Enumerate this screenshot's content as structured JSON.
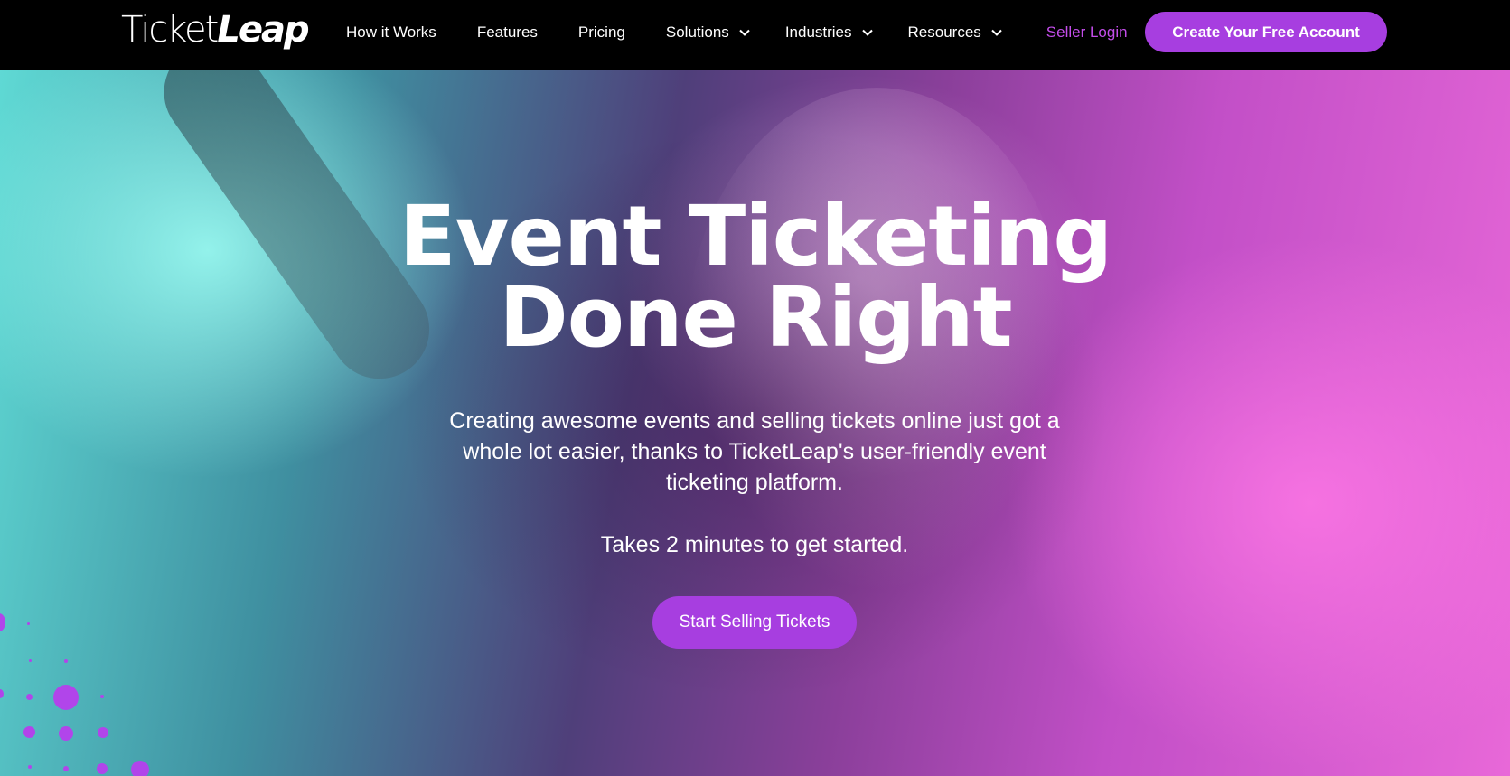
{
  "nav": {
    "logo_part1": "Ticket",
    "logo_part2": "Leap",
    "links": [
      {
        "label": "How it Works"
      },
      {
        "label": "Features"
      },
      {
        "label": "Pricing"
      },
      {
        "label": "Solutions",
        "dropdown": true
      },
      {
        "label": "Industries",
        "dropdown": true
      },
      {
        "label": "Resources",
        "dropdown": true
      }
    ],
    "seller_login": "Seller Login",
    "cta": "Create Your Free Account"
  },
  "hero": {
    "headline_line1": "Event Ticketing",
    "headline_line2": "Done Right",
    "description": "Creating awesome events and selling tickets online just got a whole lot easier, thanks to TicketLeap's user-friendly event ticketing platform.",
    "note": "Takes 2 minutes to get started.",
    "cta": "Start Selling Tickets"
  },
  "colors": {
    "accent": "#a73ee0",
    "seller_login": "#c34dea",
    "nav_bg": "#000000"
  },
  "icons": {
    "dropdown": "chevron-down-icon"
  }
}
